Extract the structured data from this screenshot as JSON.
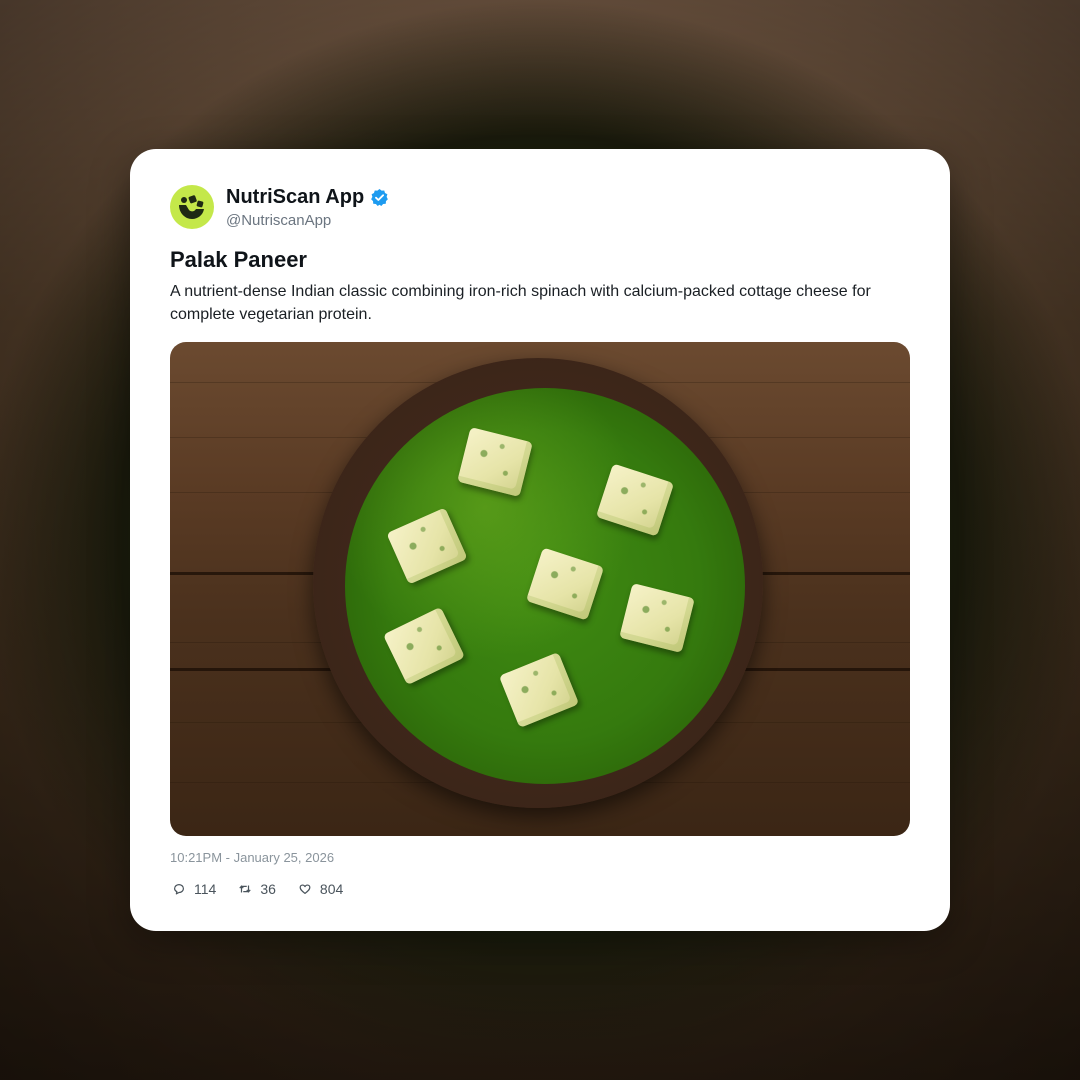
{
  "post": {
    "author_name": "NutriScan App",
    "author_handle": "@NutriscanApp",
    "verified": true,
    "title": "Palak Paneer",
    "description": "A nutrient-dense Indian classic combining iron-rich spinach with calcium-packed cottage cheese for complete vegetarian protein.",
    "timestamp": "10:21PM - January 25, 2026",
    "image_icon": "palak-paneer-photo",
    "actions": {
      "replies": "114",
      "retweets": "36",
      "likes": "804"
    }
  },
  "colors": {
    "avatar_bg": "#c4e84a",
    "verified_badge": "#1d9bf0",
    "card_bg": "#ffffff"
  }
}
